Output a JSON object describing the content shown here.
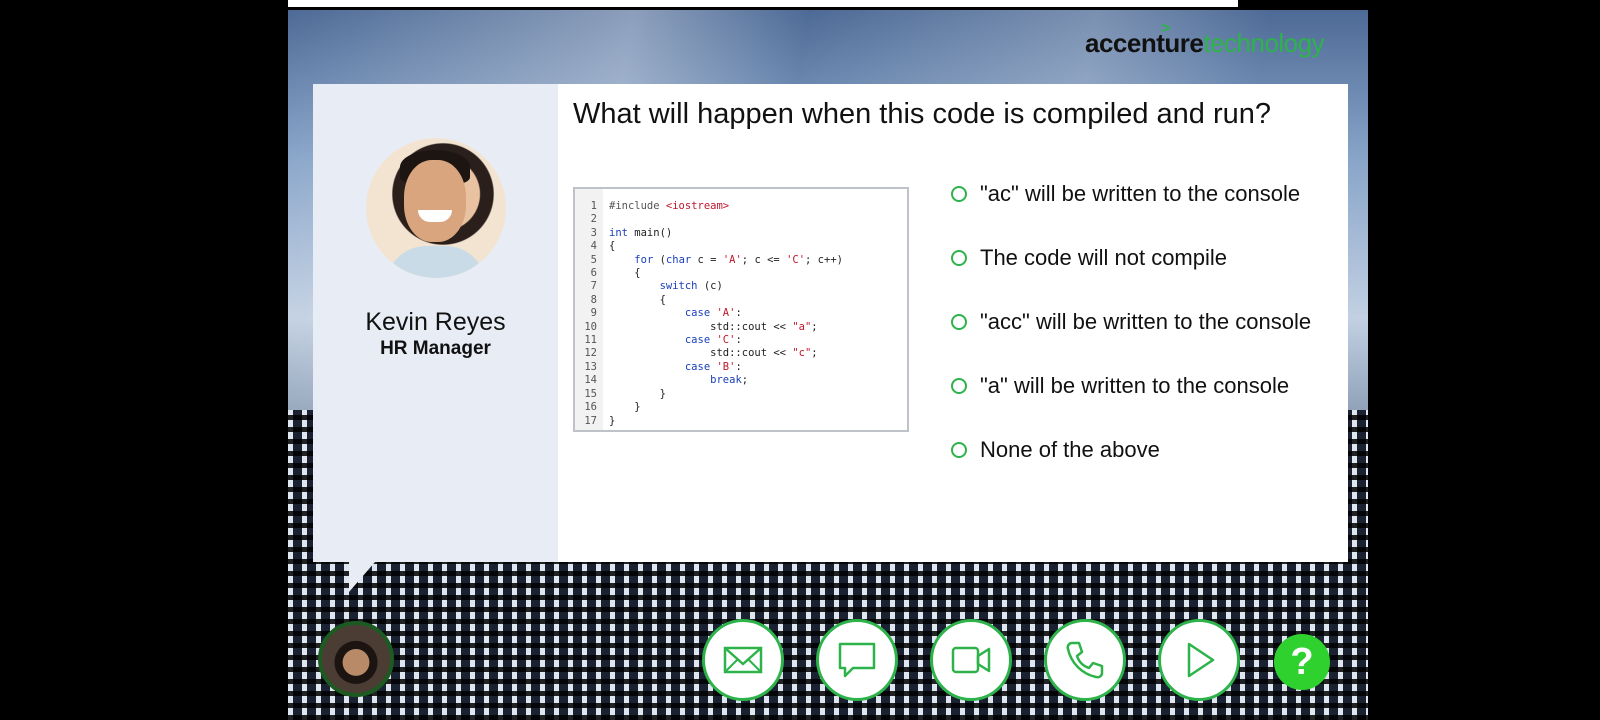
{
  "logo": {
    "part1": "accenture",
    "part2": "technology"
  },
  "person": {
    "name": "Kevin Reyes",
    "role": "HR Manager"
  },
  "question": "What will happen when this code is compiled and run?",
  "code": [
    {
      "n": "1",
      "html": "<span class='pp'>#include </span><span class='st'>&lt;iostream&gt;</span>"
    },
    {
      "n": "2",
      "html": ""
    },
    {
      "n": "3",
      "html": "<span class='kw'>int</span> main()"
    },
    {
      "n": "4",
      "html": "{"
    },
    {
      "n": "5",
      "html": "    <span class='kw'>for</span> (<span class='kw'>char</span> c = <span class='st'>'A'</span>; c &lt;= <span class='st'>'C'</span>; c++)"
    },
    {
      "n": "6",
      "html": "    {"
    },
    {
      "n": "7",
      "html": "        <span class='kw'>switch</span> (c)"
    },
    {
      "n": "8",
      "html": "        {"
    },
    {
      "n": "9",
      "html": "            <span class='kw'>case</span> <span class='st'>'A'</span>:"
    },
    {
      "n": "10",
      "html": "                std::cout &lt;&lt; <span class='st'>\"a\"</span>;"
    },
    {
      "n": "11",
      "html": "            <span class='kw'>case</span> <span class='st'>'C'</span>:"
    },
    {
      "n": "12",
      "html": "                std::cout &lt;&lt; <span class='st'>\"c\"</span>;"
    },
    {
      "n": "13",
      "html": "            <span class='kw'>case</span> <span class='st'>'B'</span>:"
    },
    {
      "n": "14",
      "html": "                <span class='kw'>break</span>;"
    },
    {
      "n": "15",
      "html": "        }"
    },
    {
      "n": "16",
      "html": "    }"
    },
    {
      "n": "17",
      "html": "}"
    }
  ],
  "options": [
    "\"ac\" will be written to the console",
    "The code will not compile",
    "\"acc\" will be written to the console",
    "\"a\" will be written to the console",
    "None of the above"
  ],
  "nav": {
    "buttons": [
      "mail-icon",
      "chat-icon",
      "video-icon",
      "phone-icon",
      "play-icon"
    ],
    "help_label": "?"
  },
  "colors": {
    "accent": "#2db34a",
    "help": "#2fd12f"
  }
}
